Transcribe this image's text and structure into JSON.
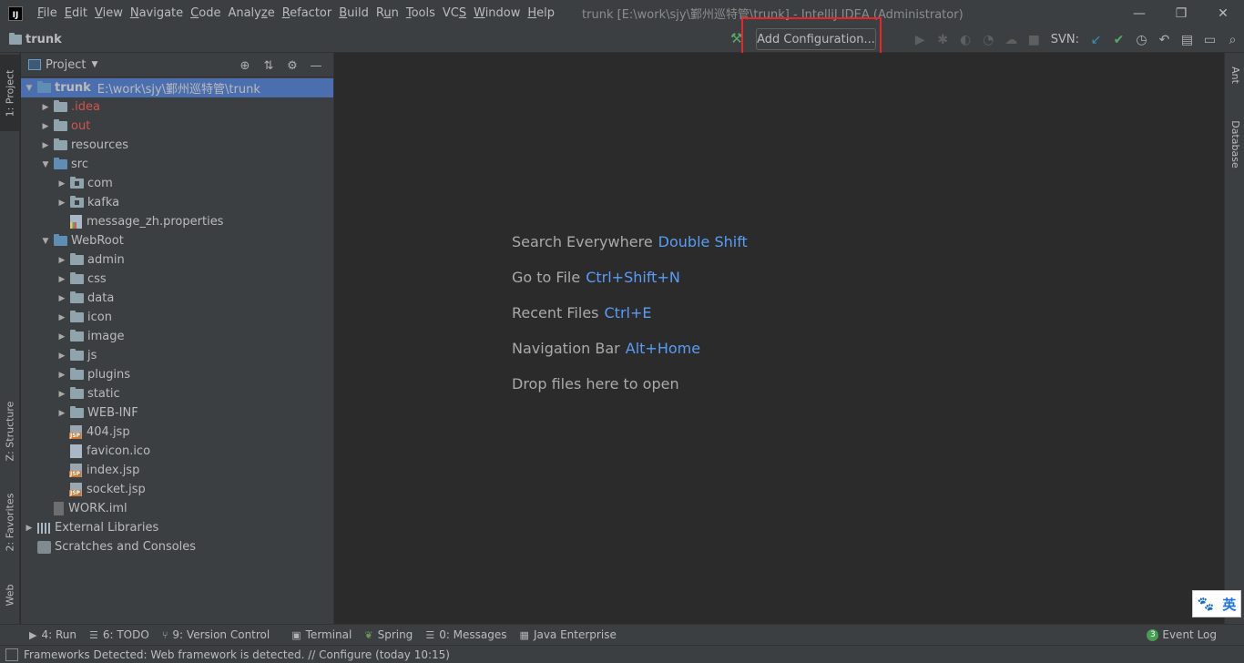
{
  "titlebar": {
    "logo": "IJ",
    "menu": [
      "File",
      "Edit",
      "View",
      "Navigate",
      "Code",
      "Analyze",
      "Refactor",
      "Build",
      "Run",
      "Tools",
      "VCS",
      "Window",
      "Help"
    ],
    "menu_underline": [
      "F",
      "E",
      "V",
      "N",
      "C",
      "z",
      "R",
      "B",
      "u",
      "T",
      "S",
      "W",
      "H"
    ],
    "window_title": "trunk [E:\\work\\sjy\\鄞州巡特管\\trunk] - IntelliJ IDEA (Administrator)",
    "minimize": "—",
    "restore": "❐",
    "close": "✕"
  },
  "navbar": {
    "project": "trunk",
    "add_configuration": "Add Configuration...",
    "svn_label": "SVN:"
  },
  "left_stripe": {
    "project_tab": "1: Project",
    "structure_tab": "Z: Structure",
    "favorites_tab": "2: Favorites",
    "web_tab": "Web"
  },
  "right_stripe": {
    "ant_tab": "Ant",
    "database_tab": "Database"
  },
  "project_panel": {
    "title": "Project",
    "tree": [
      {
        "label": "trunk",
        "path": "E:\\work\\sjy\\鄞州巡特管\\trunk",
        "indent": 0,
        "arrow": "▼",
        "icon": "folder-blue",
        "selected": true,
        "bold": true
      },
      {
        "label": ".idea",
        "indent": 1,
        "arrow": "▶",
        "icon": "folder",
        "red": true
      },
      {
        "label": "out",
        "indent": 1,
        "arrow": "▶",
        "icon": "folder",
        "red": true
      },
      {
        "label": "resources",
        "indent": 1,
        "arrow": "▶",
        "icon": "folder"
      },
      {
        "label": "src",
        "indent": 1,
        "arrow": "▼",
        "icon": "folder-blue"
      },
      {
        "label": "com",
        "indent": 2,
        "arrow": "▶",
        "icon": "package"
      },
      {
        "label": "kafka",
        "indent": 2,
        "arrow": "▶",
        "icon": "package"
      },
      {
        "label": "message_zh.properties",
        "indent": 2,
        "arrow": "",
        "icon": "props"
      },
      {
        "label": "WebRoot",
        "indent": 1,
        "arrow": "▼",
        "icon": "folder-blue"
      },
      {
        "label": "admin",
        "indent": 2,
        "arrow": "▶",
        "icon": "folder"
      },
      {
        "label": "css",
        "indent": 2,
        "arrow": "▶",
        "icon": "folder"
      },
      {
        "label": "data",
        "indent": 2,
        "arrow": "▶",
        "icon": "folder"
      },
      {
        "label": "icon",
        "indent": 2,
        "arrow": "▶",
        "icon": "folder"
      },
      {
        "label": "image",
        "indent": 2,
        "arrow": "▶",
        "icon": "folder"
      },
      {
        "label": "js",
        "indent": 2,
        "arrow": "▶",
        "icon": "folder"
      },
      {
        "label": "plugins",
        "indent": 2,
        "arrow": "▶",
        "icon": "folder"
      },
      {
        "label": "static",
        "indent": 2,
        "arrow": "▶",
        "icon": "folder"
      },
      {
        "label": "WEB-INF",
        "indent": 2,
        "arrow": "▶",
        "icon": "folder"
      },
      {
        "label": "404.jsp",
        "indent": 2,
        "arrow": "",
        "icon": "jsp"
      },
      {
        "label": "favicon.ico",
        "indent": 2,
        "arrow": "",
        "icon": "file"
      },
      {
        "label": "index.jsp",
        "indent": 2,
        "arrow": "",
        "icon": "jsp"
      },
      {
        "label": "socket.jsp",
        "indent": 2,
        "arrow": "",
        "icon": "jsp"
      },
      {
        "label": "WORK.iml",
        "indent": 1,
        "arrow": "",
        "icon": "iml"
      },
      {
        "label": "External Libraries",
        "indent": 0,
        "arrow": "▶",
        "icon": "lib"
      },
      {
        "label": "Scratches and Consoles",
        "indent": 0,
        "arrow": "",
        "icon": "scratch"
      }
    ]
  },
  "editor": {
    "hints": [
      {
        "text": "Search Everywhere",
        "key": "Double Shift"
      },
      {
        "text": "Go to File",
        "key": "Ctrl+Shift+N"
      },
      {
        "text": "Recent Files",
        "key": "Ctrl+E"
      },
      {
        "text": "Navigation Bar",
        "key": "Alt+Home"
      },
      {
        "text": "Drop files here to open",
        "key": ""
      }
    ]
  },
  "toolwindows": {
    "run": "4: Run",
    "todo": "6: TODO",
    "version_control": "9: Version Control",
    "terminal": "Terminal",
    "spring": "Spring",
    "messages": "0: Messages",
    "java_enterprise": "Java Enterprise",
    "event_log": "Event Log",
    "event_count": "3"
  },
  "statusbar": {
    "text": "Frameworks Detected: Web framework is detected. // Configure (today 10:15)"
  },
  "ime": {
    "paw": "🐾",
    "lang": "英"
  },
  "colors": {
    "accent": "#4b6eaf",
    "highlight_box": "#e8252a",
    "link": "#589df6"
  }
}
